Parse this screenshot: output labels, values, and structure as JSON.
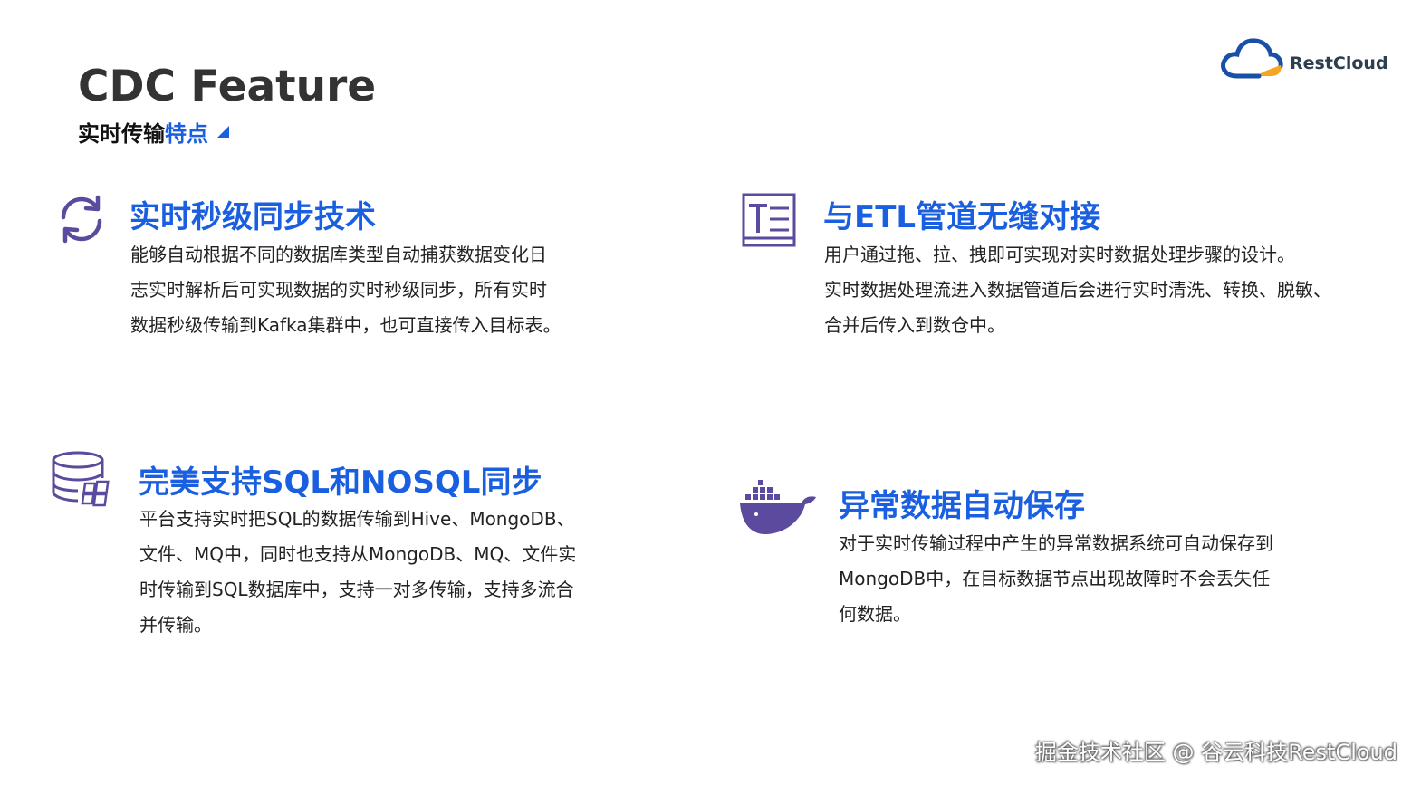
{
  "header": {
    "title": "CDC Feature",
    "subtitle_black": "实时传输",
    "subtitle_blue": "特点"
  },
  "logo": {
    "text": "RestCloud",
    "icon": "cloud-logo-icon"
  },
  "colors": {
    "accent": "#1a5fe0",
    "icon_purple": "#5b4a9e",
    "text": "#222222"
  },
  "features": [
    {
      "icon": "sync-refresh-icon",
      "title": "实时秒级同步技术",
      "lines": [
        "能够自动根据不同的数据库类型自动捕获数据变化日",
        "志实时解析后可实现数据的实时秒级同步，所有实时",
        "数据秒级传输到Kafka集群中，也可直接传入目标表。"
      ]
    },
    {
      "icon": "text-editor-icon",
      "title": "与ETL管道无缝对接",
      "lines": [
        "用户通过拖、拉、拽即可实现对实时数据处理步骤的设计。",
        "实时数据处理流进入数据管道后会进行实时清洗、转换、脱敏、",
        "合并后传入到数仓中。"
      ]
    },
    {
      "icon": "database-windows-icon",
      "title": "完美支持SQL和NOSQL同步",
      "lines": [
        "平台支持实时把SQL的数据传输到Hive、MongoDB、",
        "文件、MQ中，同时也支持从MongoDB、MQ、文件实",
        "时传输到SQL数据库中，支持一对多传输，支持多流合",
        "并传输。"
      ]
    },
    {
      "icon": "docker-whale-icon",
      "title": "异常数据自动保存",
      "lines": [
        "对于实时传输过程中产生的异常数据系统可自动保存到",
        "MongoDB中，在目标数据节点出现故障时不会丢失任",
        "何数据。"
      ]
    }
  ],
  "watermark": "掘金技术社区 @ 谷云科技RestCloud"
}
